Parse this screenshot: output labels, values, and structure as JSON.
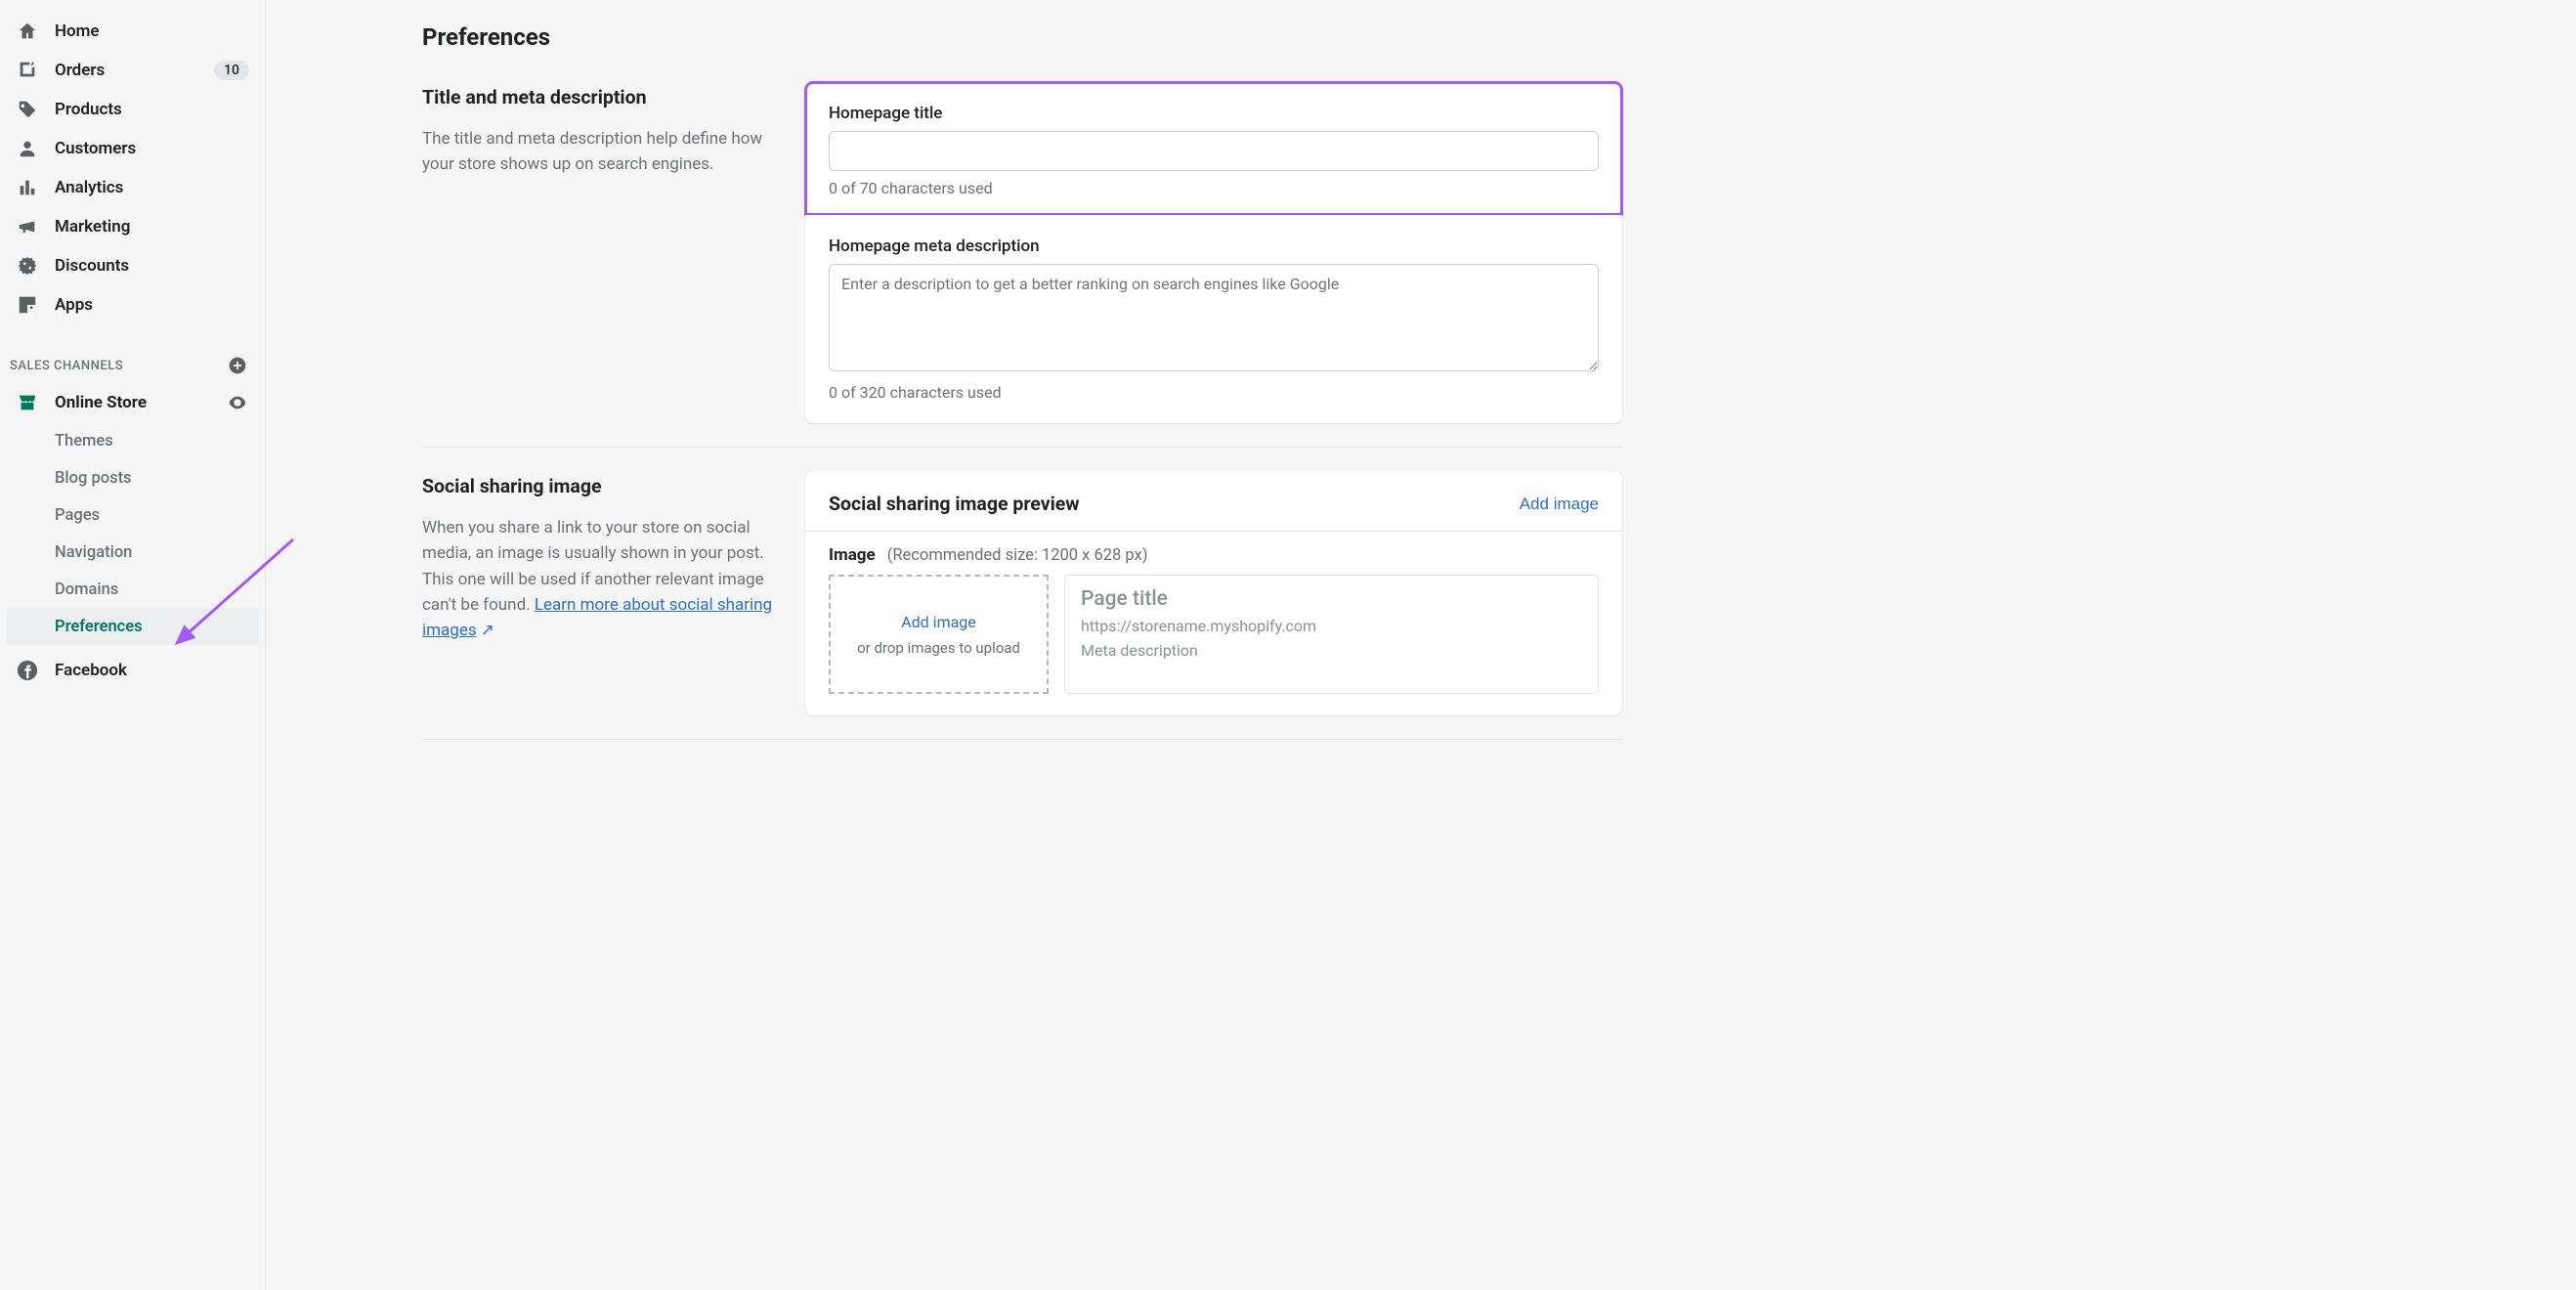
{
  "sidebar": {
    "items": [
      {
        "label": "Home"
      },
      {
        "label": "Orders",
        "badge": "10"
      },
      {
        "label": "Products"
      },
      {
        "label": "Customers"
      },
      {
        "label": "Analytics"
      },
      {
        "label": "Marketing"
      },
      {
        "label": "Discounts"
      },
      {
        "label": "Apps"
      }
    ],
    "channels_header": "SALES CHANNELS",
    "online_store": {
      "label": "Online Store"
    },
    "sub_items": [
      {
        "label": "Themes"
      },
      {
        "label": "Blog posts"
      },
      {
        "label": "Pages"
      },
      {
        "label": "Navigation"
      },
      {
        "label": "Domains"
      },
      {
        "label": "Preferences"
      }
    ],
    "facebook": {
      "label": "Facebook"
    }
  },
  "page": {
    "title": "Preferences"
  },
  "meta_section": {
    "heading": "Title and meta description",
    "desc": "The title and meta description help define how your store shows up on search engines.",
    "title_label": "Homepage title",
    "title_helper": "0 of 70 characters used",
    "desc_label": "Homepage meta description",
    "desc_placeholder": "Enter a description to get a better ranking on search engines like Google",
    "desc_helper": "0 of 320 characters used"
  },
  "social_section": {
    "heading": "Social sharing image",
    "desc_prefix": "When you share a link to your store on social media, an image is usually shown in your post. This one will be used if another relevant image can't be found. ",
    "link_text": "Learn more about social sharing images",
    "card_heading": "Social sharing image preview",
    "add_image": "Add image",
    "image_label": "Image",
    "recommended": "(Recommended size: 1200 x 628 px)",
    "drop_add": "Add image",
    "drop_hint": "or drop images to upload",
    "preview_title": "Page title",
    "preview_url": "https://storename.myshopify.com",
    "preview_meta": "Meta description"
  }
}
